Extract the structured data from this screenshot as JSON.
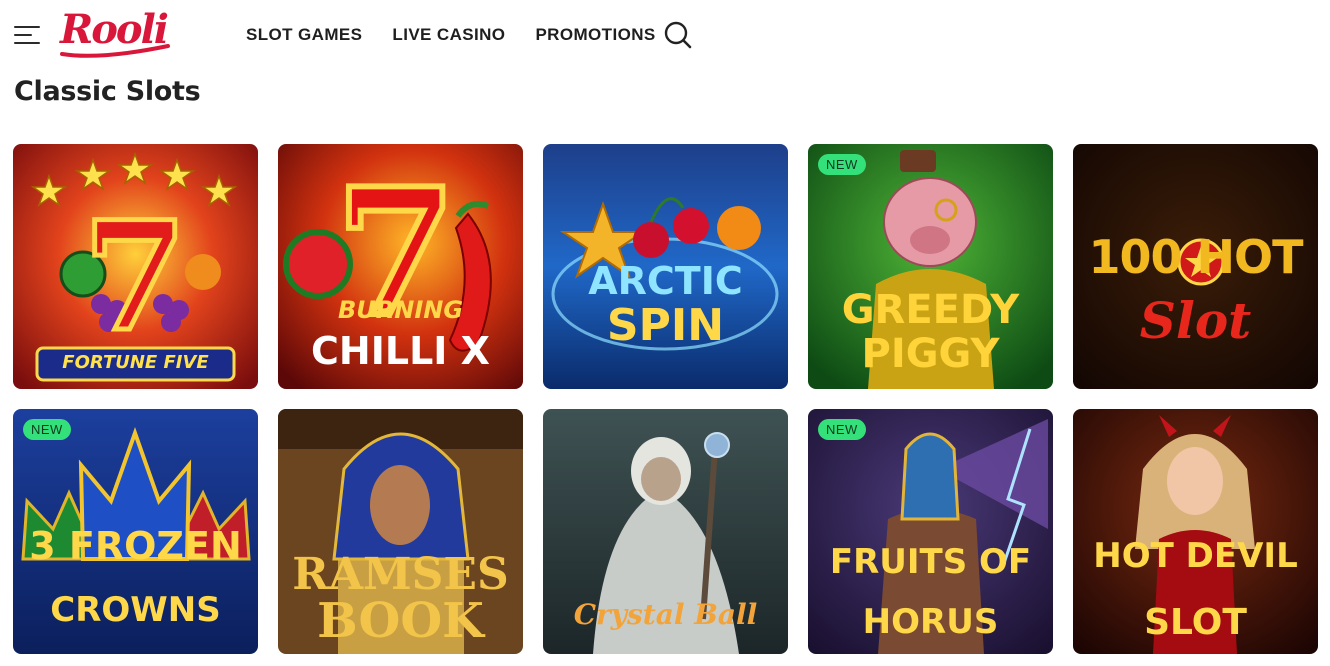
{
  "header": {
    "logo_text": "Rooli",
    "nav": [
      {
        "label": "SLOT GAMES"
      },
      {
        "label": "LIVE CASINO"
      },
      {
        "label": "PROMOTIONS"
      }
    ]
  },
  "page_title": "Classic Slots",
  "games": [
    {
      "title_line1": "FORTUNE FIVE",
      "title_line2": "",
      "badge": ""
    },
    {
      "title_line1": "BURNING",
      "title_line2": "CHILLI X",
      "badge": ""
    },
    {
      "title_line1": "ARCTIC",
      "title_line2": "SPIN",
      "badge": ""
    },
    {
      "title_line1": "GREEDY",
      "title_line2": "PIGGY",
      "badge": "NEW"
    },
    {
      "title_line1": "100 HOT",
      "title_line2": "Slot",
      "badge": ""
    },
    {
      "title_line1": "3 FROZEN",
      "title_line2": "CROWNS",
      "badge": "NEW"
    },
    {
      "title_line1": "RAMSES",
      "title_line2": "BOOK",
      "badge": ""
    },
    {
      "title_line1": "Crystal Ball",
      "title_line2": "",
      "badge": ""
    },
    {
      "title_line1": "FRUITS OF",
      "title_line2": "HORUS",
      "badge": "NEW"
    },
    {
      "title_line1": "HOT DEVIL",
      "title_line2": "SLOT",
      "badge": ""
    }
  ],
  "colors": {
    "brand": "#d8173a",
    "badge": "#34e07a"
  }
}
